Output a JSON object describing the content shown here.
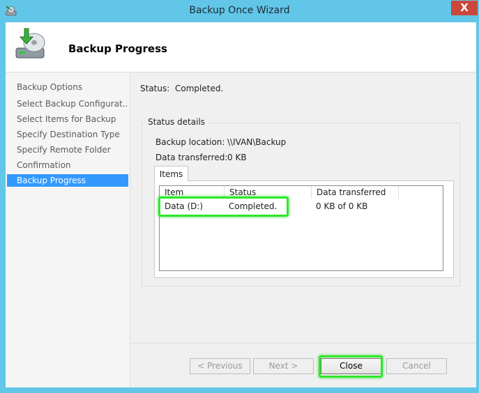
{
  "window": {
    "title": "Backup Once Wizard",
    "close_glyph": "X"
  },
  "header": {
    "title": "Backup Progress",
    "icon": "backup-drive-icon"
  },
  "nav": {
    "items": [
      "Backup Options",
      "Select Backup Configurat...",
      "Select Items for Backup",
      "Specify Destination Type",
      "Specify Remote Folder",
      "Confirmation",
      "Backup Progress"
    ],
    "active_index": 6
  },
  "status": {
    "label": "Status:",
    "value": "Completed."
  },
  "details": {
    "title": "Status details",
    "location_label": "Backup location:",
    "location_value": "\\\\IVAN\\Backup",
    "transferred_label": "Data transferred:",
    "transferred_value": "0 KB"
  },
  "tabs": {
    "items": "Items"
  },
  "table": {
    "columns": [
      "Item",
      "Status",
      "Data transferred"
    ],
    "rows": [
      {
        "item": "Data (D:)",
        "status": "Completed.",
        "transferred": "0 KB of 0 KB"
      }
    ]
  },
  "buttons": {
    "previous": "< Previous",
    "next": "Next >",
    "close": "Close",
    "cancel": "Cancel"
  },
  "colors": {
    "title_bar": "#62c6e8",
    "selection": "#3399ff",
    "highlight": "#2ee82a",
    "close_button": "#c9473b"
  }
}
